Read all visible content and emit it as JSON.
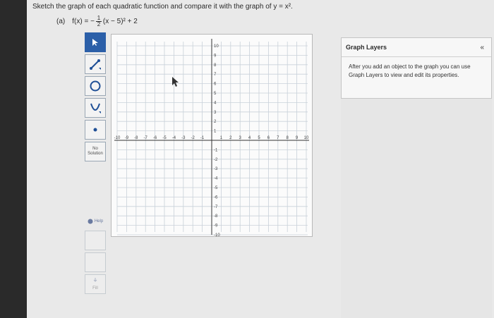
{
  "question": "Sketch the graph of each quadratic function and compare it with the graph of y = x².",
  "part": {
    "label": "(a)",
    "lhs": "f(x) = −",
    "frac_num": "1",
    "frac_den": "2",
    "rhs": "(x − 5)² + 2"
  },
  "tools": {
    "no_solution_line1": "No",
    "no_solution_line2": "Solution",
    "help_label": "Help",
    "fill_label": "Fill"
  },
  "graph": {
    "x_ticks": [
      "-10",
      "-9",
      "-8",
      "-7",
      "-6",
      "-5",
      "-4",
      "-3",
      "-2",
      "-1",
      "1",
      "2",
      "3",
      "4",
      "5",
      "6",
      "7",
      "8",
      "9",
      "10"
    ],
    "y_ticks": [
      "10",
      "9",
      "8",
      "7",
      "6",
      "5",
      "4",
      "3",
      "2",
      "1",
      "-1",
      "-2",
      "-3",
      "-4",
      "-5",
      "-6",
      "-7",
      "-8",
      "-9",
      "-10"
    ]
  },
  "layers": {
    "title": "Graph Layers",
    "collapse": "«",
    "body": "After you add an object to the graph you can use Graph Layers to view and edit its properties."
  }
}
